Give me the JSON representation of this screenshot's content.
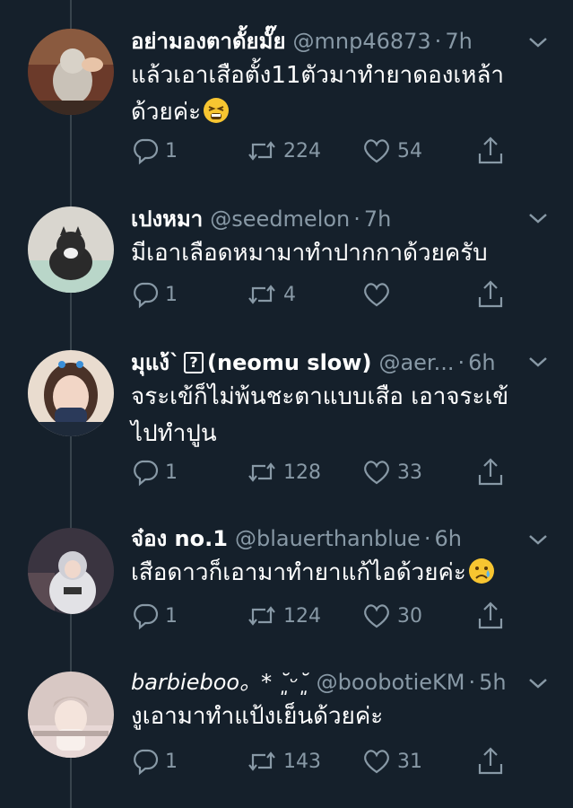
{
  "tweets": [
    {
      "name": "อย่ามองตาดั้ยมั๊ย",
      "handle": "@mnp46873",
      "time": "7h",
      "text": "แล้วเอาเสือตั้ง11ตัวมาทำยาดองเหล้าด้วยค่ะ",
      "emoji": "tired-face-emoji",
      "replies": "1",
      "retweets": "224",
      "likes": "54"
    },
    {
      "name": "เปงหมา",
      "handle": "@seedmelon",
      "time": "7h",
      "text": "มีเอาเลือดหมามาทำปากกาด้วยครับ",
      "replies": "1",
      "retweets": "4",
      "likes": ""
    },
    {
      "name": "มุแง้`",
      "name_suffix": "(neomu slow)",
      "handle": "@aer...",
      "time": "6h",
      "text": "จระเข้ก็ไม่พ้นชะตาแบบเสือ เอาจระเข้ไปทำปูน",
      "replies": "1",
      "retweets": "128",
      "likes": "33"
    },
    {
      "name": "จ๋อง no.1",
      "handle": "@blauerthanblue",
      "time": "6h",
      "text": "เสือดาวก็เอามาทำยาแก้ไอด้วยค่ะ",
      "emoji": "crying-face-emoji",
      "replies": "1",
      "retweets": "124",
      "likes": "30"
    },
    {
      "name": "barbieboo。* ˘͈ᵕ˘͈",
      "handle": "@boobotieKM",
      "time": "5h",
      "text": "งูเอามาทำแป้งเย็นด้วยค่ะ",
      "replies": "1",
      "retweets": "143",
      "likes": "31"
    }
  ],
  "colors": {
    "background": "#15202b",
    "muted": "#8899a6",
    "text": "#ffffff",
    "thread_line": "#38444d"
  }
}
